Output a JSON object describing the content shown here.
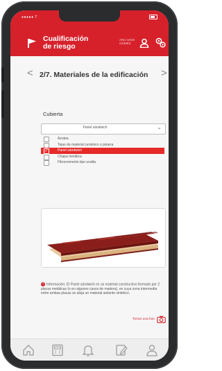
{
  "status": {
    "carrier": "●●●●● T",
    "icons": [
      "battery-icon"
    ]
  },
  "header": {
    "title_line1": "Cualificación",
    "title_line2": "de riesgo",
    "user_line1": "ARIJ UNIO",
    "user_line2": "GOMEZ",
    "icons": [
      "flag-icon",
      "user-icon",
      "gear-icon"
    ]
  },
  "nav": {
    "prev": "<",
    "next": ">",
    "title": "2/7. Materiales de la edificación"
  },
  "form": {
    "label": "Cubierta",
    "selected_value": "Panel sándwich",
    "options": [
      {
        "label": "Azotea",
        "checked": false
      },
      {
        "label": "Tejas de material cerámico o pizarra",
        "checked": false
      },
      {
        "label": "Panel sándwich",
        "checked": true
      },
      {
        "label": "Chapa metálica",
        "checked": false
      },
      {
        "label": "Fibrocemento tipo uralita",
        "checked": false
      }
    ]
  },
  "info": {
    "text": "Información: El Panel sándwich es un material constructivo formado por 2 placas metálicas (o en algunos casos de madera), en cuya zona intermedia entre ambas placas se aloja un material aislante sintético."
  },
  "photo": {
    "label": "Tomar una foto"
  },
  "tabs": [
    "home-icon",
    "calculator-icon",
    "bell-icon",
    "edit-icon",
    "profile-icon"
  ],
  "colors": {
    "brand_red": "#d6212b",
    "selection_red": "#e62a2a",
    "panel_red": "#8a1e1a",
    "foam": "#e8c9a0"
  }
}
